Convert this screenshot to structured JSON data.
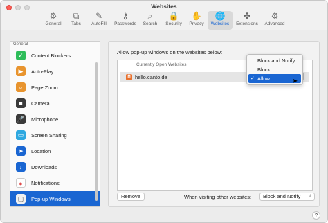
{
  "window": {
    "title": "Websites"
  },
  "toolbar": {
    "tabs": [
      {
        "label": "General",
        "icon": "gear-icon",
        "glyph": "⚙"
      },
      {
        "label": "Tabs",
        "icon": "tabs-icon",
        "glyph": "⧉"
      },
      {
        "label": "AutoFill",
        "icon": "autofill-icon",
        "glyph": "✎"
      },
      {
        "label": "Passwords",
        "icon": "key-icon",
        "glyph": "⚷"
      },
      {
        "label": "Search",
        "icon": "search-icon",
        "glyph": "⌕"
      },
      {
        "label": "Security",
        "icon": "lock-icon",
        "glyph": "🔒"
      },
      {
        "label": "Privacy",
        "icon": "hand-icon",
        "glyph": "✋"
      },
      {
        "label": "Websites",
        "icon": "globe-icon",
        "glyph": "🌐"
      },
      {
        "label": "Extensions",
        "icon": "puzzle-icon",
        "glyph": "✣"
      },
      {
        "label": "Advanced",
        "icon": "gears-icon",
        "glyph": "⚙"
      }
    ],
    "active_tab": "Websites",
    "accent_color": "#1a66d2"
  },
  "sidebar": {
    "header": "General",
    "items": [
      {
        "label": "Content Blockers",
        "icon": "content-blockers-icon",
        "color": "#2ebd5a",
        "glyph": "✓"
      },
      {
        "label": "Auto-Play",
        "icon": "auto-play-icon",
        "color": "#e8942e",
        "glyph": "▶"
      },
      {
        "label": "Page Zoom",
        "icon": "page-zoom-icon",
        "color": "#e8942e",
        "glyph": "⌕"
      },
      {
        "label": "Camera",
        "icon": "camera-icon",
        "color": "#3a3a3a",
        "glyph": "■"
      },
      {
        "label": "Microphone",
        "icon": "microphone-icon",
        "color": "#3a3a3a",
        "glyph": "🎤"
      },
      {
        "label": "Screen Sharing",
        "icon": "screen-sharing-icon",
        "color": "#2ea8e0",
        "glyph": "▭"
      },
      {
        "label": "Location",
        "icon": "location-icon",
        "color": "#1a66d2",
        "glyph": "➤"
      },
      {
        "label": "Downloads",
        "icon": "downloads-icon",
        "color": "#1a66d2",
        "glyph": "↓"
      },
      {
        "label": "Notifications",
        "icon": "notifications-icon",
        "color": "#e04b4b",
        "glyph": "●"
      },
      {
        "label": "Pop-up Windows",
        "icon": "popup-windows-icon",
        "color": "#555555",
        "glyph": "▢"
      }
    ],
    "selected": "Pop-up Windows"
  },
  "main": {
    "label": "Allow pop-up windows on the websites below:",
    "list_header": "Currently Open Websites",
    "site": {
      "name": "hello.canto.de",
      "icon": "site-favicon-icon"
    },
    "remove_label": "Remove",
    "other_label": "When visiting other websites:",
    "other_value": "Block and Notify"
  },
  "menu": {
    "options": [
      "Block and Notify",
      "Block",
      "Allow"
    ],
    "selected": "Allow",
    "check_glyph": "✓"
  },
  "help": {
    "label": "?"
  }
}
